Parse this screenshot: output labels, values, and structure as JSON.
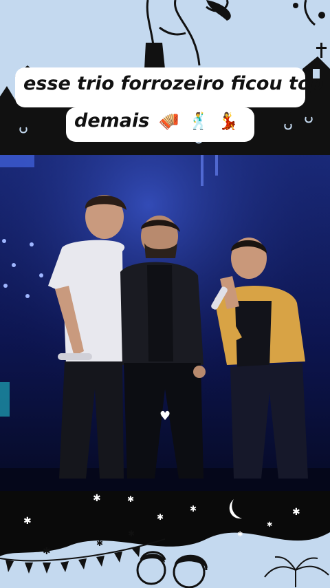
{
  "caption": {
    "line1": "esse trio forrozeiro ficou top",
    "line2": "demais",
    "emojis": [
      "🪗",
      "🕺",
      "💃"
    ]
  },
  "overlay": {
    "heart_icon": "♥"
  },
  "colors": {
    "background": "#c4d9ef",
    "stage": "#0b0f3a",
    "ink": "#111111"
  }
}
